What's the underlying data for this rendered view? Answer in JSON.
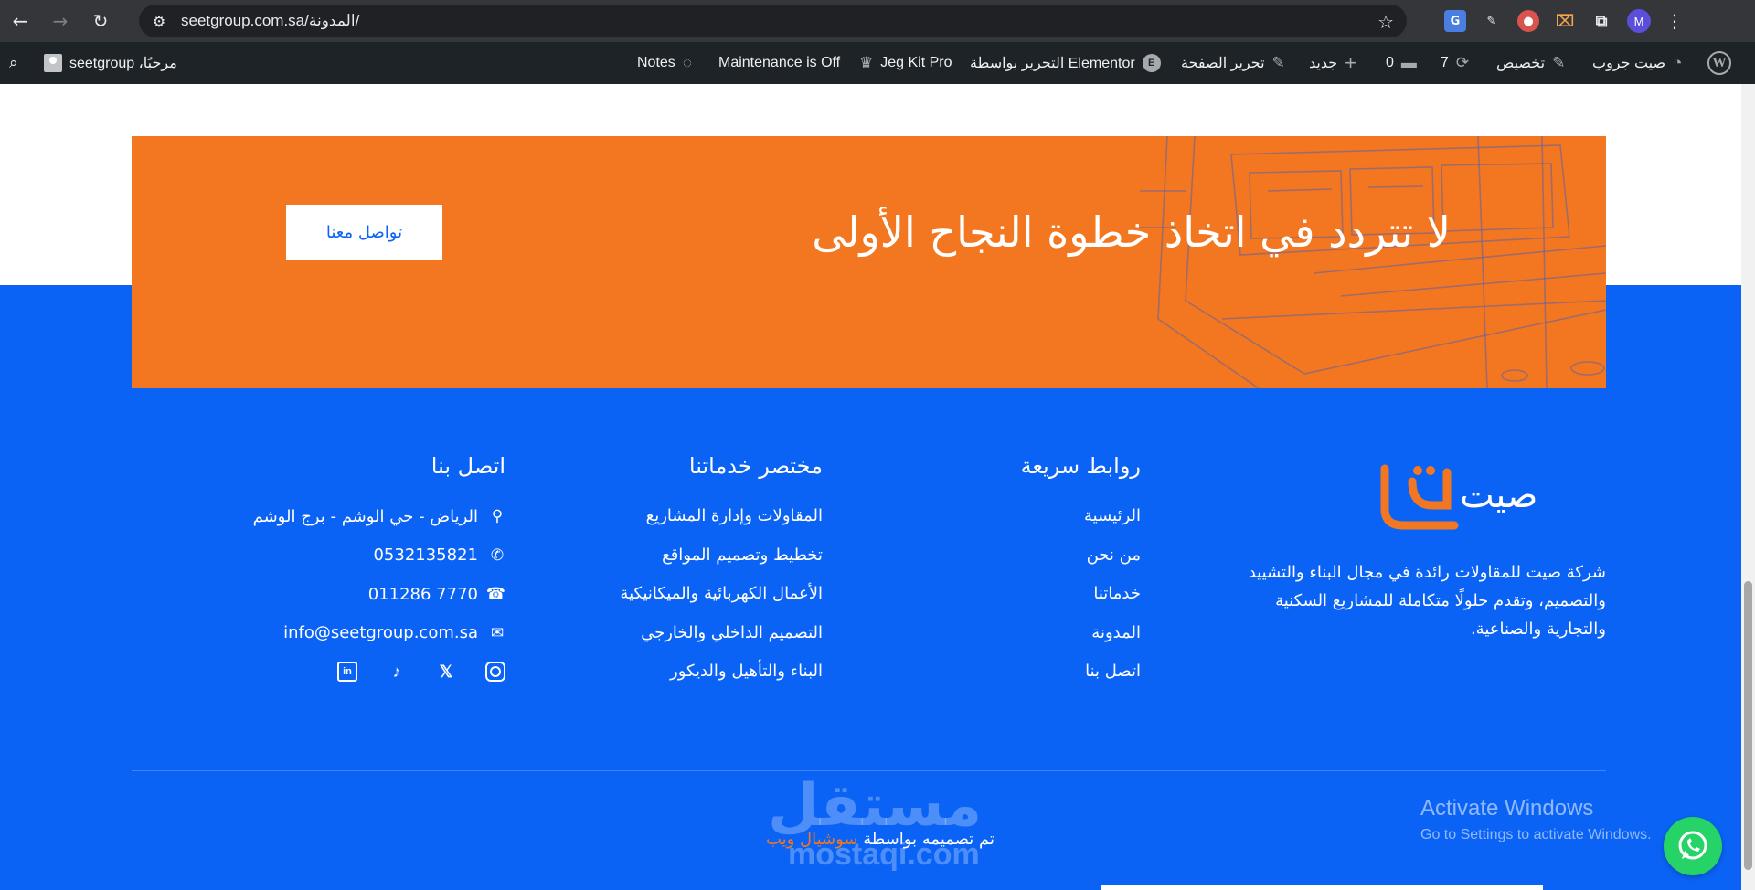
{
  "browser": {
    "url": "seetgroup.com.sa/المدونة/",
    "avatar_letter": "M"
  },
  "adminbar": {
    "site_name": "صيت جروب",
    "customize": "تخصيص",
    "updates_count": "7",
    "comments_count": "0",
    "new": "جديد",
    "edit_page": "تحرير الصفحة",
    "edit_with_elementor": "التحرير بواسطة Elementor",
    "jeg_kit": "Jeg Kit Pro",
    "maintenance": "Maintenance is Off",
    "notes": "Notes",
    "greeting": "مرحبًا، seetgroup"
  },
  "cta": {
    "title": "لا تتردد في اتخاذ خطوة النجاح الأولى",
    "button": "تواصل معنا"
  },
  "footer": {
    "logo_text": "صيت",
    "about": "شركة صيت للمقاولات رائدة في مجال البناء والتشييد والتصميم، وتقدم حلولًا متكاملة للمشاريع السكنية والتجارية والصناعية.",
    "quick_links": {
      "heading": "روابط سريعة",
      "items": [
        "الرئيسية",
        "من نحن",
        "خدماتنا",
        "المدونة",
        "اتصل بنا"
      ]
    },
    "services": {
      "heading": "مختصر خدماتنا",
      "items": [
        "المقاولات وإدارة المشاريع",
        "تخطيط وتصميم المواقع",
        "الأعمال الكهربائية والميكانيكية",
        "التصميم الداخلي والخارجي",
        "البناء والتأهيل والديكور"
      ]
    },
    "contact": {
      "heading": "اتصل بنا",
      "address": "الرياض - حي الوشم - برج الوشم",
      "mobile": "0532135821",
      "phone": "011286 7770",
      "email": "info@seetgroup.com.sa"
    },
    "credit_prefix": "تم تصميمه بواسطة",
    "credit_brand": "سوشيال ويب"
  },
  "overlays": {
    "watermark_ar": "مستقل",
    "watermark_en": "mostaqi.com",
    "activate_title": "Activate Windows",
    "activate_sub": "Go to Settings to activate Windows."
  },
  "colors": {
    "brand_blue": "#0b63f6",
    "brand_orange": "#f37720",
    "whatsapp": "#25d366"
  },
  "icons": {
    "back": "arrow-left-icon",
    "forward": "arrow-right-icon",
    "reload": "reload-icon",
    "location": "map-pin-icon",
    "mobile": "phone-icon",
    "phone": "telephone-icon",
    "email": "envelope-icon"
  }
}
